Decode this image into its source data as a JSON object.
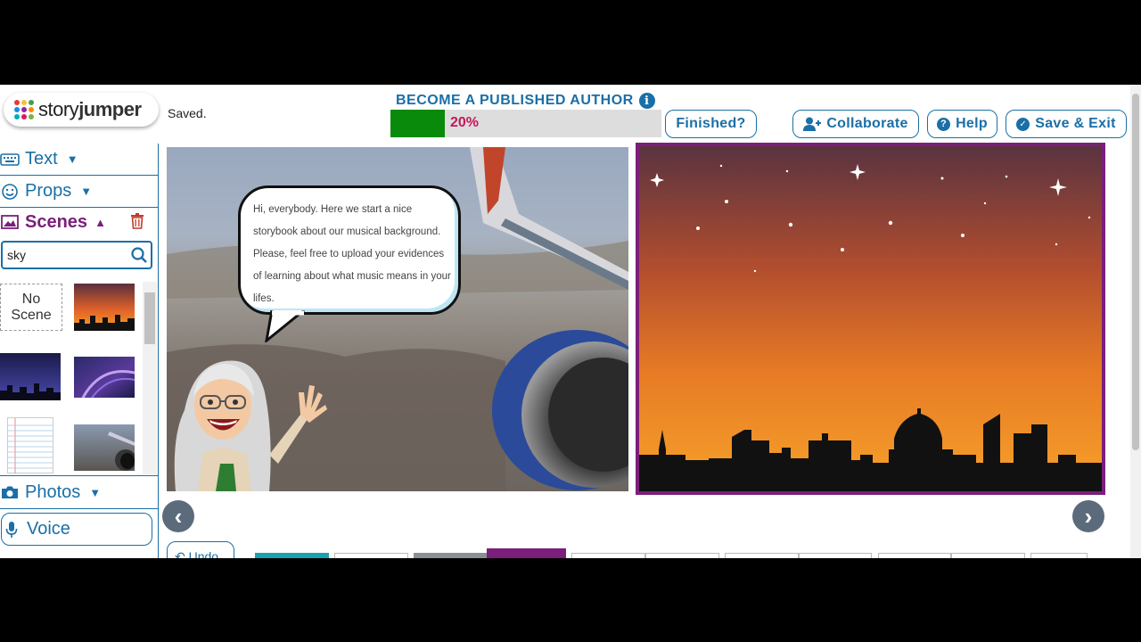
{
  "header": {
    "logo_text_a": "story",
    "logo_text_b": "jumper",
    "status": "Saved.",
    "promo_title": "BECOME A PUBLISHED AUTHOR",
    "progress_percent": 20,
    "progress_label": "20%",
    "finished_label": "Finished?",
    "collaborate_label": "Collaborate",
    "help_label": "Help",
    "save_exit_label": "Save & Exit"
  },
  "sidebar": {
    "text_label": "Text",
    "props_label": "Props",
    "scenes_label": "Scenes",
    "search_value": "sky",
    "no_scene_label": "No Scene",
    "photos_label": "Photos",
    "voice_label": "Voice"
  },
  "page": {
    "speech_text": "Hi, everybody. Here we start a nice storybook about our musical background. Please, feel free to upload your evidences of learning about what music means in your lifes."
  },
  "footer": {
    "undo_label": "Undo"
  },
  "colors": {
    "accent": "#1a6fa6",
    "scenes": "#7a1f7a",
    "progress": "#0a8a0a",
    "progress_text": "#c2185b",
    "selected_page_border": "#7a1f7a"
  },
  "icons": [
    "info-icon",
    "keyboard-icon",
    "smiley-icon",
    "image-icon",
    "trash-icon",
    "search-icon",
    "camera-icon",
    "microphone-icon",
    "user-plus-icon",
    "question-icon",
    "check-icon",
    "undo-icon",
    "arrow-left-icon",
    "arrow-right-icon"
  ]
}
